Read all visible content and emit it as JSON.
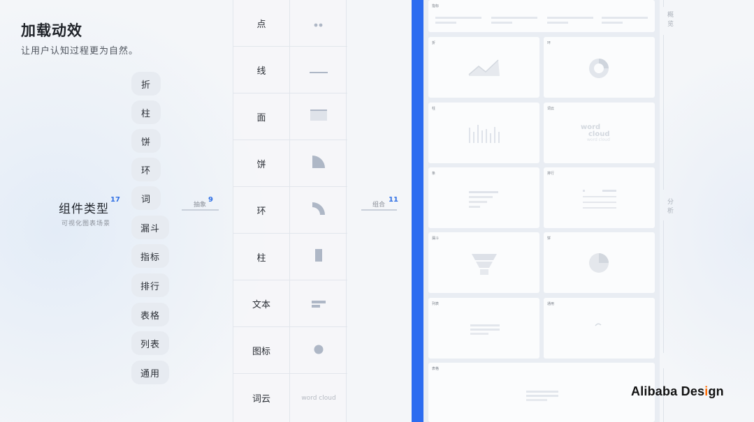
{
  "header": {
    "title": "加载动效",
    "subtitle": "让用户认知过程更为自然。"
  },
  "component_group": {
    "label": "组件类型",
    "count": "17",
    "sub": "可视化图表场景"
  },
  "component_types": [
    "折",
    "柱",
    "饼",
    "环",
    "词",
    "漏斗",
    "指标",
    "排行",
    "表格",
    "列表",
    "通用"
  ],
  "connector_abstract": {
    "label": "抽象",
    "count": "9"
  },
  "connector_combine": {
    "label": "组合",
    "count": "11"
  },
  "abstract_rows": [
    {
      "label": "点",
      "icon": "dots-icon"
    },
    {
      "label": "线",
      "icon": "line-icon"
    },
    {
      "label": "面",
      "icon": "surface-icon"
    },
    {
      "label": "饼",
      "icon": "pie-quarter-icon"
    },
    {
      "label": "环",
      "icon": "ring-quarter-icon"
    },
    {
      "label": "柱",
      "icon": "bar-icon"
    },
    {
      "label": "文本",
      "icon": "text-lines-icon"
    },
    {
      "label": "图标",
      "icon": "circle-icon"
    },
    {
      "label": "词云",
      "icon": "word-cloud-text",
      "text": "word cloud"
    }
  ],
  "preview_cards": [
    {
      "title": "指标",
      "kind": "metric"
    },
    {
      "title": "折",
      "kind": "line"
    },
    {
      "title": "环",
      "kind": "ring"
    },
    {
      "title": "柱",
      "kind": "bar"
    },
    {
      "title": "词云",
      "kind": "wordcloud",
      "words": [
        "word",
        "cloud",
        "word cloud"
      ]
    },
    {
      "title": "条",
      "kind": "hbar"
    },
    {
      "title": "排行",
      "kind": "rank"
    },
    {
      "title": "漏斗",
      "kind": "funnel"
    },
    {
      "title": "饼",
      "kind": "pie"
    },
    {
      "title": "列表",
      "kind": "list"
    },
    {
      "title": "通用",
      "kind": "generic"
    },
    {
      "title": "表格",
      "kind": "table"
    }
  ],
  "side_labels": [
    "概览",
    "分析"
  ],
  "brand": {
    "pre": "Alibaba Des",
    "dot": "i",
    "post": "gn"
  },
  "colors": {
    "accent": "#2c6cf0",
    "count": "#2f6fe4",
    "placeholder": "#c4cad3",
    "brand_dot": "#ff6a00"
  }
}
